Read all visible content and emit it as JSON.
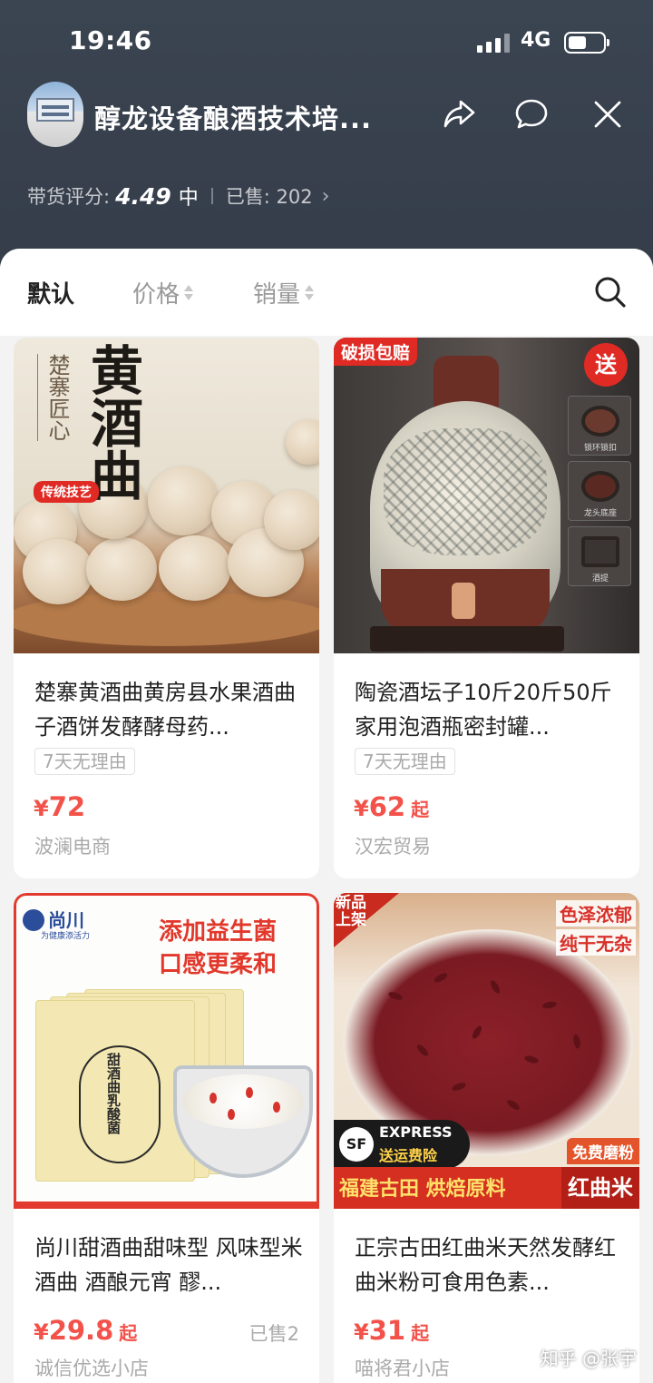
{
  "status_bar": {
    "time": "19:46",
    "network": "4G"
  },
  "shop": {
    "name": "醇龙设备酿酒技术培...",
    "rating_label": "带货评分:",
    "rating_value": "4.49",
    "rating_level": "中",
    "sold_label": "已售: 202"
  },
  "sort_bar": {
    "items": [
      {
        "label": "默认",
        "active": true
      },
      {
        "label": "价格",
        "active": false
      },
      {
        "label": "销量",
        "active": false
      }
    ]
  },
  "products": [
    {
      "title": "楚寨黄酒曲黄房县水果酒曲子酒饼发酵酵母药...",
      "tag": "7天无理由",
      "price_currency": "¥",
      "price": "72",
      "price_suffix": "",
      "shop": "波澜电商",
      "sold": "",
      "image_text": {
        "main": "黄酒曲",
        "side": "楚寨匠心",
        "ribbon": "传统技艺"
      }
    },
    {
      "title": "陶瓷酒坛子10斤20斤50斤家用泡酒瓶密封罐...",
      "tag": "7天无理由",
      "price_currency": "¥",
      "price": "62",
      "price_suffix": "起",
      "shop": "汉宏贸易",
      "sold": "",
      "image_text": {
        "badge": "破损包赔",
        "gift": "送",
        "thumbs": [
          "锁环锁扣",
          "龙头底座",
          "酒提"
        ]
      }
    },
    {
      "title": "尚川甜酒曲甜味型 风味型米酒曲 酒酿元宵 醪...",
      "tag": "",
      "price_currency": "¥",
      "price": "29.8",
      "price_suffix": "起",
      "shop": "诚信优选小店",
      "sold": "已售2",
      "image_text": {
        "brand": "尚川",
        "brand_slogan": "为健康添活力",
        "line1": "添加益生菌",
        "line2": "口感更柔和",
        "pack": "甜酒曲乳酸菌"
      }
    },
    {
      "title": "正宗古田红曲米天然发酵红曲米粉可食用色素...",
      "tag": "",
      "price_currency": "¥",
      "price": "31",
      "price_suffix": "起",
      "shop": "喵将君小店",
      "sold": "",
      "image_text": {
        "new": "新品上架",
        "corner1": "色泽浓郁",
        "corner2": "纯干无杂",
        "express": "EXPRESS",
        "express_sub": "送运费险",
        "free": "免费磨粉",
        "bar": "福建古田 烘焙原料",
        "bar_end": "红曲米"
      }
    }
  ],
  "watermark": "知乎 @张宇",
  "colors": {
    "price": "#f2524a",
    "header_bg": "#3b4451",
    "panel_bg": "#f3f3f3"
  }
}
